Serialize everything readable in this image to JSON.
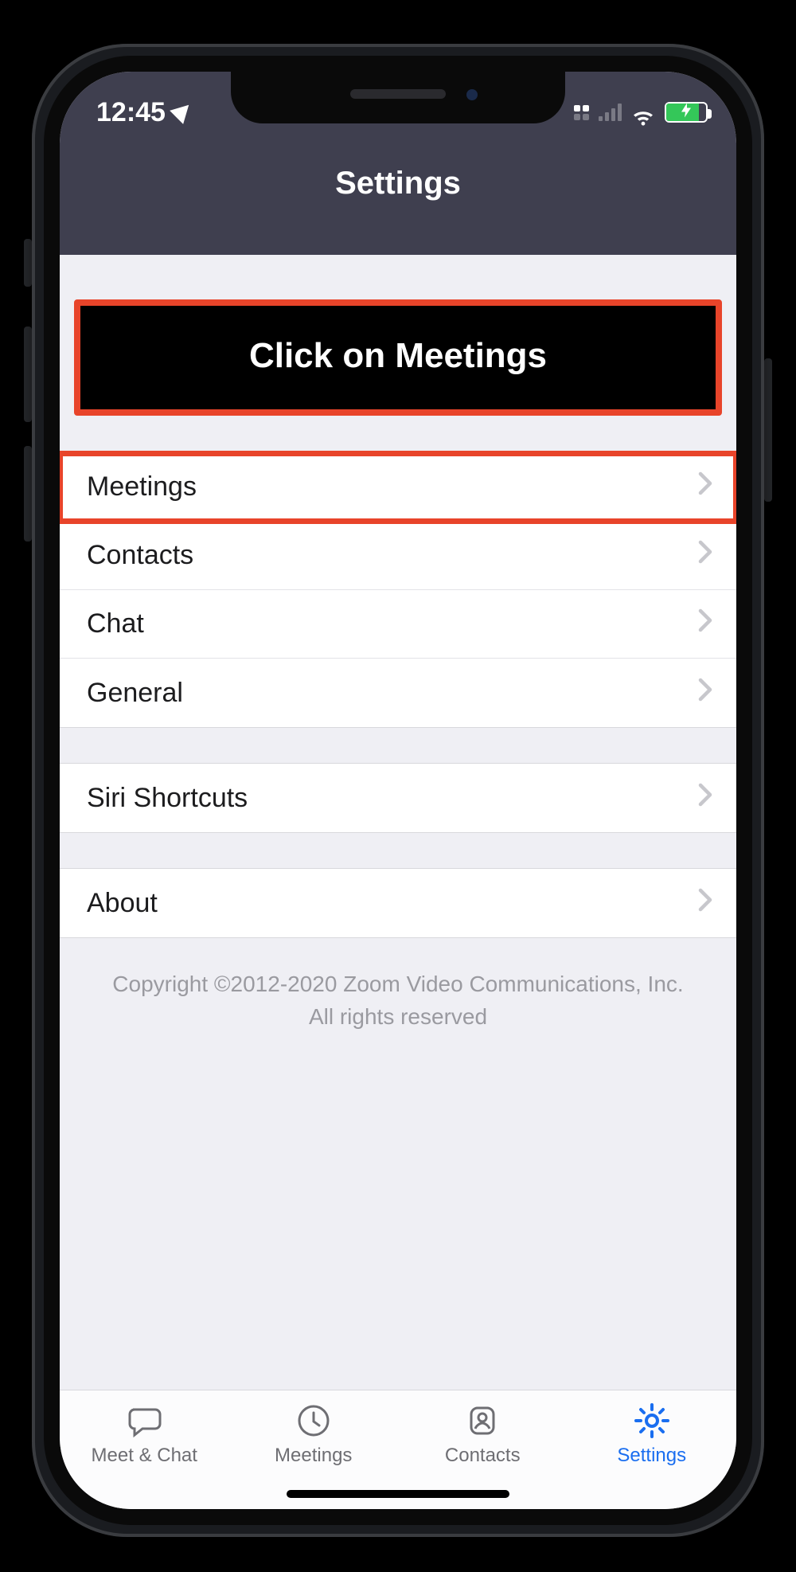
{
  "status": {
    "time": "12:45",
    "location_services": true,
    "battery_charging": true
  },
  "header": {
    "title": "Settings"
  },
  "callout": {
    "text": "Click on Meetings"
  },
  "sections": [
    {
      "rows": [
        {
          "label": "Meetings",
          "highlighted": true
        },
        {
          "label": "Contacts"
        },
        {
          "label": "Chat"
        },
        {
          "label": "General"
        }
      ]
    },
    {
      "rows": [
        {
          "label": "Siri Shortcuts"
        }
      ]
    },
    {
      "rows": [
        {
          "label": "About"
        }
      ]
    }
  ],
  "footer": {
    "line1": "Copyright ©2012-2020 Zoom Video Communications, Inc.",
    "line2": "All rights reserved"
  },
  "tabbar": {
    "items": [
      {
        "label": "Meet & Chat",
        "icon": "chat",
        "active": false
      },
      {
        "label": "Meetings",
        "icon": "clock",
        "active": false
      },
      {
        "label": "Contacts",
        "icon": "contacts",
        "active": false
      },
      {
        "label": "Settings",
        "icon": "gear",
        "active": true
      }
    ]
  }
}
